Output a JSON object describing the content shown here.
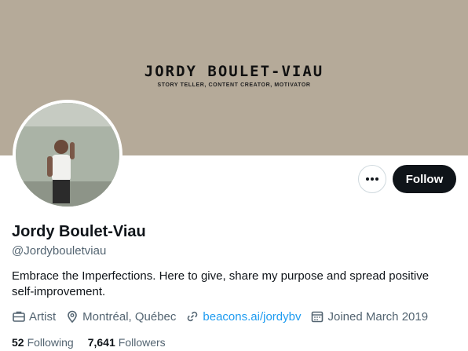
{
  "banner": {
    "title": "JORDY BOULET-VIAU",
    "subtitle": "STORY TELLER, CONTENT CREATOR, MOTIVATOR"
  },
  "profile": {
    "name": "Jordy Boulet-Viau",
    "handle": "@Jordybouletviau",
    "bio": "Embrace the Imperfections. Here to give, share my purpose and spread positive self-improvement."
  },
  "actions": {
    "more_icon": "ellipsis-icon",
    "follow_label": "Follow"
  },
  "meta": {
    "category": "Artist",
    "location": "Montréal, Québec",
    "link": "beacons.ai/jordybv",
    "joined": "Joined March 2019"
  },
  "stats": {
    "following_count": "52",
    "following_label": "Following",
    "followers_count": "7,641",
    "followers_label": "Followers"
  },
  "colors": {
    "banner": "#b5aa99",
    "text_primary": "#0f1419",
    "text_secondary": "#536471",
    "link": "#1d9bf0",
    "follow_button_bg": "#0f1419"
  }
}
